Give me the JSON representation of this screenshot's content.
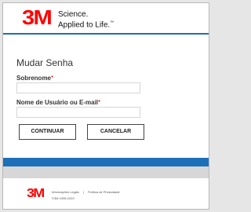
{
  "header": {
    "logo": "3M",
    "tagline_line1": "Science.",
    "tagline_line2": "Applied to Life.",
    "tm": "™"
  },
  "form": {
    "title": "Mudar Senha",
    "last_name_label": "Sobrenome",
    "username_label": "Nome de Usuário ou E-mail",
    "required_mark": "*",
    "last_name_value": "",
    "username_value": ""
  },
  "buttons": {
    "continue_label": "CONTINUAR",
    "cancel_label": "CANCELAR"
  },
  "footer": {
    "logo": "3M",
    "legal_link": "Informações Legais",
    "separator": "|",
    "privacy_link": "Política de Privacidade",
    "copyright": "©3M 1995-2020"
  },
  "colors": {
    "brand_red": "#ff0000",
    "accent_blue": "#1d6fb8",
    "footer_band_grey": "#d7d7d7"
  }
}
